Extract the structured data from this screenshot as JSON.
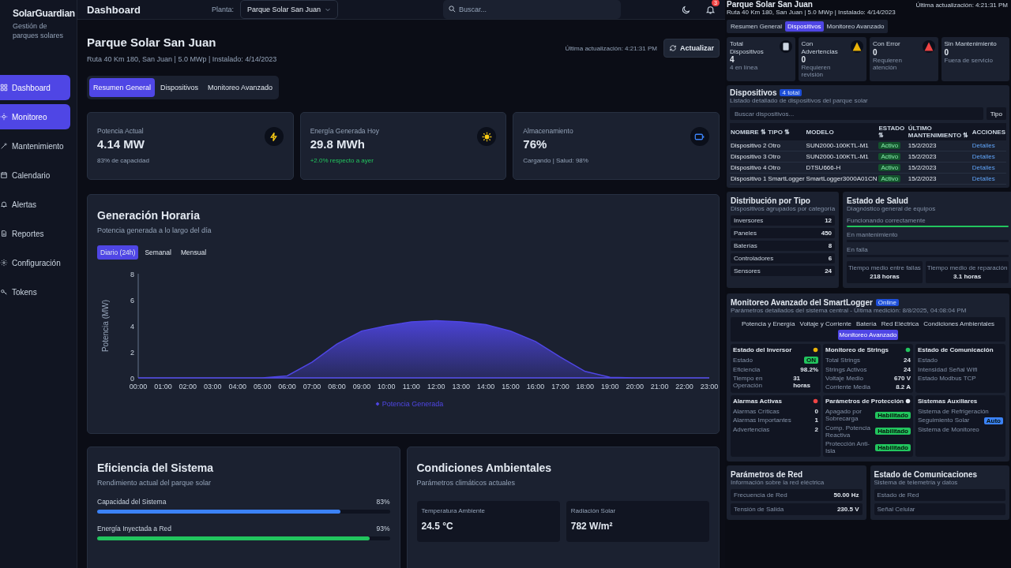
{
  "sidebar": {
    "brand": "SolarGuardian",
    "tagline": "Gestión de parques solares",
    "items": [
      {
        "label": "Dashboard",
        "selected": true
      },
      {
        "label": "Monitoreo",
        "selected": true
      },
      {
        "label": "Mantenimiento",
        "selected": false
      },
      {
        "label": "Calendario",
        "selected": false
      },
      {
        "label": "Alertas",
        "selected": false
      },
      {
        "label": "Reportes",
        "selected": false
      },
      {
        "label": "Configuración",
        "selected": false
      },
      {
        "label": "Tokens",
        "selected": false
      }
    ]
  },
  "topbar": {
    "title": "Dashboard",
    "plant_label": "Planta:",
    "plant_value": "Parque Solar San Juan",
    "search_placeholder": "Buscar...",
    "notification_count": "3"
  },
  "header": {
    "title": "Parque Solar San Juan",
    "subtitle": "Ruta 40 Km 180, San Juan | 5.0 MWp | Instalado: 4/14/2023",
    "last_update": "Última actualización: 4:21:31 PM",
    "refresh_button": "Actualizar"
  },
  "tabs": [
    {
      "label": "Resumen General",
      "selected": true
    },
    {
      "label": "Dispositivos",
      "selected": false
    },
    {
      "label": "Monitoreo Avanzado",
      "selected": false
    }
  ],
  "kpis": [
    {
      "label": "Potencia Actual",
      "value": "4.14 MW",
      "note": "83% de capacidad",
      "kind": "neutral",
      "color": "#facc15"
    },
    {
      "label": "Energía Generada Hoy",
      "value": "29.8 MWh",
      "note": "+2.0% respecto a ayer",
      "kind": "positive",
      "color": "#facc15"
    },
    {
      "label": "Almacenamiento",
      "value": "76%",
      "note": "Cargando | Salud: 98%",
      "kind": "neutral",
      "color": "#3b82f6"
    }
  ],
  "generation": {
    "title": "Generación Horaria",
    "subtitle": "Potencia generada a lo largo del día",
    "periods": [
      {
        "label": "Diario (24h)",
        "selected": true
      },
      {
        "label": "Semanal",
        "selected": false
      },
      {
        "label": "Mensual",
        "selected": false
      }
    ],
    "chart_data": {
      "type": "area",
      "ylabel": "Potencia (MW)",
      "categories": [
        "00:00",
        "01:00",
        "02:00",
        "03:00",
        "04:00",
        "05:00",
        "06:00",
        "07:00",
        "08:00",
        "09:00",
        "10:00",
        "11:00",
        "12:00",
        "13:00",
        "14:00",
        "15:00",
        "16:00",
        "17:00",
        "18:00",
        "19:00",
        "20:00",
        "21:00",
        "22:00",
        "23:00"
      ],
      "ylim": [
        0,
        8
      ],
      "yticks": [
        0,
        2,
        4,
        6,
        8
      ],
      "series": [
        {
          "name": "Potencia Generada",
          "color": "#4f46e5",
          "values": [
            0,
            0,
            0,
            0,
            0,
            0,
            0.15,
            1.2,
            2.6,
            3.6,
            4.0,
            4.3,
            4.4,
            4.3,
            4.1,
            3.6,
            2.8,
            1.6,
            0.5,
            0.05,
            0,
            0,
            0,
            0
          ]
        }
      ]
    }
  },
  "efficiency": {
    "title": "Eficiencia del Sistema",
    "subtitle": "Rendimiento actual del parque solar",
    "metrics": [
      {
        "label": "Capacidad del Sistema",
        "reading": "83%",
        "level": 0.83,
        "color": "#3b82f6"
      },
      {
        "label": "Energía Inyectada a Red",
        "reading": "93%",
        "level": 0.93,
        "color": "#22c55e"
      }
    ]
  },
  "environment": {
    "title": "Condiciones Ambientales",
    "subtitle": "Parámetros climáticos actuales",
    "readings": [
      {
        "label": "Temperatura Ambiente",
        "value": "24.5 °C"
      },
      {
        "label": "Radiación Solar",
        "value": "782 W/m²"
      }
    ]
  },
  "devices_view": {
    "title": "Parque Solar San Juan",
    "subtitle": "Ruta 40 Km 180, San Juan | 5.0 MWp | Instalado: 4/14/2023",
    "last_update": "Última actualización: 4:21:31 PM",
    "tabs": [
      {
        "label": "Resumen General",
        "selected": false
      },
      {
        "label": "Dispositivos",
        "selected": true
      },
      {
        "label": "Monitoreo Avanzado",
        "selected": false
      }
    ],
    "stats": [
      {
        "label": "Total Dispositivos",
        "value": "4",
        "note": "4 en línea",
        "color": "#cbd5e1"
      },
      {
        "label": "Con Advertencias",
        "value": "0",
        "note": "Requieren revisión",
        "color": "#eab308"
      },
      {
        "label": "Con Error",
        "value": "0",
        "note": "Requieren atención",
        "color": "#ef4444"
      },
      {
        "label": "Sin Mantenimiento",
        "value": "0",
        "note": "Fuera de servicio"
      }
    ],
    "devices": {
      "title": "Dispositivos",
      "badge": "4 total",
      "subtitle": "Listado detallado de dispositivos del parque solar",
      "search_placeholder": "Buscar dispositivos...",
      "filter_button": "Tipo",
      "columns": [
        "NOMBRE ⇅",
        "TIPO ⇅",
        "MODELO",
        "ESTADO ⇅",
        "ÚLTIMO MANTENIMIENTO ⇅",
        "ACCIONES"
      ],
      "rows": [
        {
          "name": "Dispositivo 2",
          "type": "Otro",
          "model": "SUN2000-100KTL-M1",
          "status": "Activo",
          "maintenance": "15/2/2023",
          "action": "Detalles"
        },
        {
          "name": "Dispositivo 3",
          "type": "Otro",
          "model": "SUN2000-100KTL-M1",
          "status": "Activo",
          "maintenance": "15/2/2023",
          "action": "Detalles"
        },
        {
          "name": "Dispositivo 4",
          "type": "Otro",
          "model": "DTSU666-H",
          "status": "Activo",
          "maintenance": "15/2/2023",
          "action": "Detalles"
        },
        {
          "name": "Dispositivo 1",
          "type": "SmartLogger",
          "model": "SmartLogger3000A01CN",
          "status": "Activo",
          "maintenance": "15/2/2023",
          "action": "Detalles"
        }
      ]
    },
    "distribution": {
      "title": "Distribución por Tipo",
      "subtitle": "Dispositivos agrupados por categoría",
      "items": [
        {
          "label": "Inversores",
          "value": "12"
        },
        {
          "label": "Paneles",
          "value": "450"
        },
        {
          "label": "Baterías",
          "value": "8"
        },
        {
          "label": "Controladores",
          "value": "6"
        },
        {
          "label": "Sensores",
          "value": "24"
        }
      ]
    },
    "health": {
      "title": "Estado de Salud",
      "subtitle": "Diagnóstico general de equipos",
      "bars": [
        {
          "label": "Funcionando correctamente",
          "level": 1
        },
        {
          "label": "En mantenimiento"
        },
        {
          "label": "En falla"
        }
      ],
      "stats": [
        {
          "label": "Tiempo medio entre fallas",
          "value": "218 horas"
        },
        {
          "label": "Tiempo medio de reparación",
          "value": "3.1 horas"
        }
      ]
    },
    "smartlogger": {
      "title": "Monitoreo Avanzado del SmartLogger",
      "badge": "Online",
      "subtitle": "Parámetros detallados del sistema central - Última medición: 8/8/2025, 04:08:04 PM",
      "tabs": [
        {
          "label": "Potencia y Energía",
          "selected": false
        },
        {
          "label": "Voltaje y Corriente",
          "selected": false
        },
        {
          "label": "Batería",
          "selected": false
        },
        {
          "label": "Red Eléctrica",
          "selected": false
        },
        {
          "label": "Condiciones Ambientales",
          "selected": false
        },
        {
          "label": "Monitoreo Avanzado",
          "selected": true
        }
      ],
      "panels": [
        {
          "title": "Estado del Inversor",
          "color": "#eab308",
          "rows": [
            {
              "label": "Estado",
              "value": "ON",
              "kind": "badge",
              "color": "#22c55e"
            },
            {
              "label": "Eficiencia",
              "value": "98.2%",
              "kind": "text"
            },
            {
              "label": "Tiempo en Operación",
              "value": "31 horas",
              "kind": "text"
            }
          ]
        },
        {
          "title": "Monitoreo de Strings",
          "color": "#22c55e",
          "rows": [
            {
              "label": "Total Strings",
              "value": "24",
              "kind": "text"
            },
            {
              "label": "Strings Activos",
              "value": "24",
              "kind": "text"
            },
            {
              "label": "Voltaje Medio",
              "value": "670 V",
              "kind": "text"
            },
            {
              "label": "Corriente Media",
              "value": "8.2 A",
              "kind": "text"
            }
          ]
        },
        {
          "title": "Estado de Comunicación",
          "rows": [
            {
              "label": "Estado"
            },
            {
              "label": "Intensidad Señal Wifi"
            },
            {
              "label": "Estado Modbus TCP"
            }
          ]
        },
        {
          "title": "Alarmas Activas",
          "color": "#ef4444",
          "rows": [
            {
              "label": "Alarmas Críticas",
              "value": "0",
              "kind": "text"
            },
            {
              "label": "Alarmas Importantes",
              "value": "1",
              "kind": "text"
            },
            {
              "label": "Advertencias",
              "value": "2",
              "kind": "text"
            }
          ]
        },
        {
          "title": "Parámetros de Protección",
          "color": "#e2e8f0",
          "rows": [
            {
              "label": "Apagado por Sobrecarga",
              "value": "Habilitado",
              "kind": "badge",
              "color": "#22c55e"
            },
            {
              "label": "Comp. Potencia Reactiva",
              "value": "Habilitado",
              "kind": "badge",
              "color": "#22c55e"
            },
            {
              "label": "Protección Anti-Isla",
              "value": "Habilitado",
              "kind": "badge",
              "color": "#22c55e"
            }
          ]
        },
        {
          "title": "Sistemas Auxiliares",
          "rows": [
            {
              "label": "Sistema de Refrigeración"
            },
            {
              "label": "Seguimiento Solar",
              "value": "Auto",
              "kind": "badge",
              "color": "#3b82f6"
            },
            {
              "label": "Sistema de Monitoreo"
            }
          ]
        }
      ]
    },
    "grid": {
      "title": "Parámetros de Red",
      "subtitle": "Información sobre la red eléctrica",
      "rows": [
        {
          "label": "Frecuencia de Red",
          "value": "50.00 Hz"
        },
        {
          "label": "Tensión de Salida",
          "value": "230.5 V"
        }
      ]
    },
    "comms": {
      "title": "Estado de Comunicaciones",
      "subtitle": "Sistema de telemetría y datos",
      "rows": [
        {
          "label": "Estado de Red"
        },
        {
          "label": "Señal Celular"
        }
      ]
    }
  }
}
